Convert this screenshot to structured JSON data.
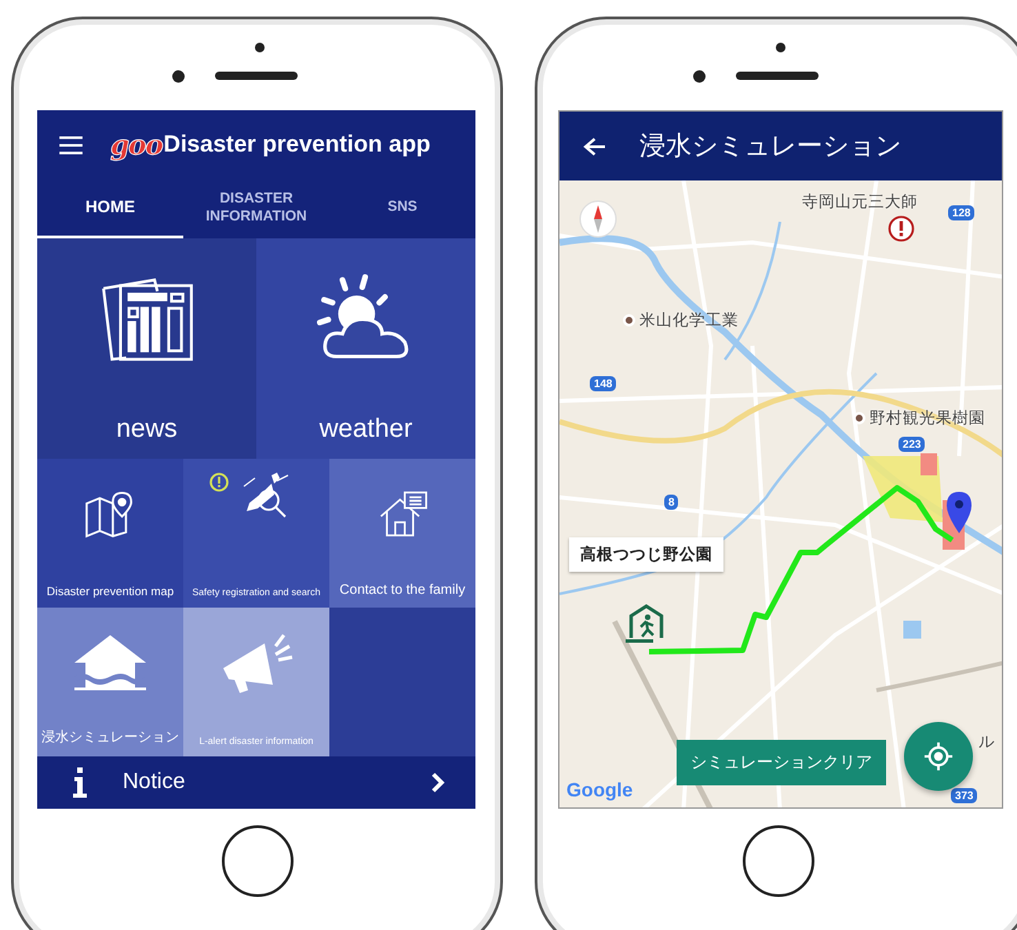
{
  "home_screen": {
    "logo": "goo",
    "title": "Disaster prevention app",
    "tabs": [
      {
        "label": "HOME",
        "selected": true
      },
      {
        "label": "DISASTER INFORMATION",
        "selected": false
      },
      {
        "label": "SNS",
        "selected": false
      }
    ],
    "tiles": [
      {
        "kind": "news",
        "label": "news"
      },
      {
        "kind": "weather",
        "label": "weather"
      },
      {
        "kind": "map",
        "label": "Disaster prevention map"
      },
      {
        "kind": "safety",
        "label": "Safety registration and search"
      },
      {
        "kind": "contact",
        "label": "Contact to the family"
      },
      {
        "kind": "flood",
        "label": "浸水シミュレーション"
      },
      {
        "kind": "alert",
        "label": "L-alert disaster information"
      }
    ],
    "notice": {
      "label": "Notice"
    }
  },
  "map_screen": {
    "title": "浸水シミュレーション",
    "places": [
      {
        "label": "寺岡山元三大師",
        "dot": false
      },
      {
        "label": "米山化学工業",
        "dot": true
      },
      {
        "label": "野村観光果樹園",
        "dot": true
      },
      {
        "label": "ル",
        "dot": false
      }
    ],
    "road_numbers": [
      "128",
      "148",
      "223",
      "8",
      "373"
    ],
    "callout": "高根つつじ野公園",
    "clear_button": "シミュレーションクリア",
    "attribution": "Google"
  }
}
